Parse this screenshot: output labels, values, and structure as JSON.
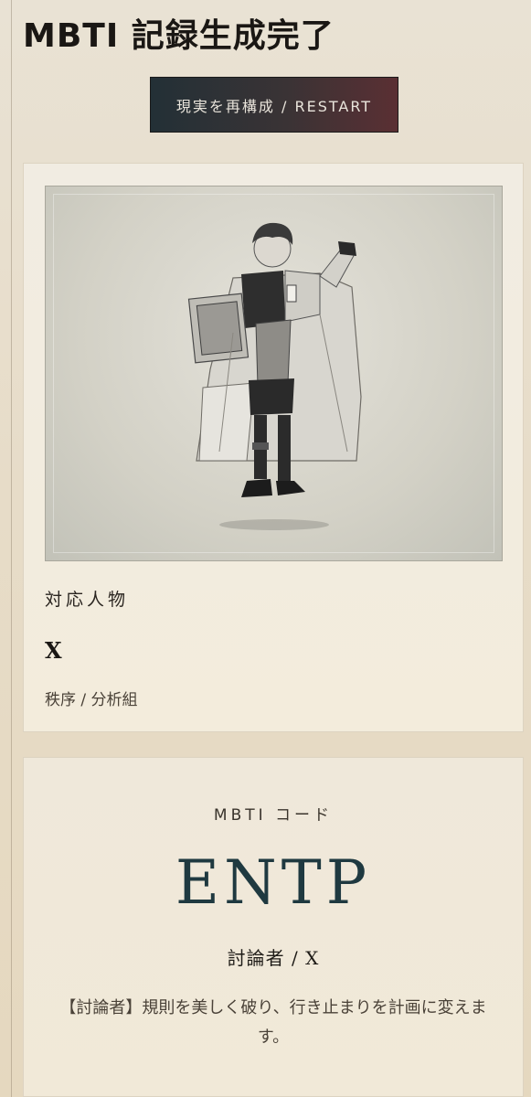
{
  "header": {
    "title": "MBTI 記録生成完了",
    "restart_label": "現実を再構成 / RESTART"
  },
  "character": {
    "role_label": "対応人物",
    "name": "X",
    "group": "秩序 / 分析組"
  },
  "mbti": {
    "label": "MBTI コード",
    "code": "ENTP",
    "subtitle": "討論者 / X",
    "description": "【討論者】規則を美しく破り、行き止まりを計画に変えます。"
  },
  "colors": {
    "code_color": "#1f3940",
    "button_gradient_start": "#233036",
    "button_gradient_end": "#5a2f33"
  }
}
